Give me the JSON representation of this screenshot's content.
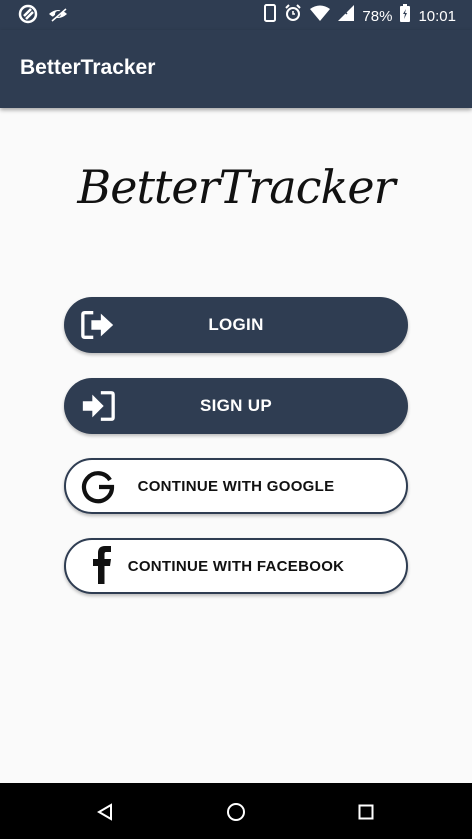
{
  "status_bar": {
    "battery": "78%",
    "time": "10:01",
    "icons": [
      "app-notification-icon",
      "eye-off-icon",
      "phone-icon",
      "alarm-icon",
      "wifi-icon",
      "signal-icon",
      "battery-icon"
    ]
  },
  "app_bar": {
    "title": "BetterTracker"
  },
  "logo": {
    "text": "BetterTracker"
  },
  "buttons": {
    "login": {
      "label": "LOGIN",
      "icon": "login-arrow-icon"
    },
    "signup": {
      "label": "SIGN UP",
      "icon": "enter-door-icon"
    },
    "google": {
      "label": "CONTINUE WITH GOOGLE",
      "icon": "google-g-icon"
    },
    "facebook": {
      "label": "CONTINUE WITH FACEBOOK",
      "icon": "facebook-f-icon"
    }
  },
  "colors": {
    "primary": "#2f3d52",
    "background": "#fafafa",
    "nav_bar": "#000000"
  },
  "nav_bar": {
    "icons": [
      "back-icon",
      "home-icon",
      "recents-icon"
    ]
  }
}
